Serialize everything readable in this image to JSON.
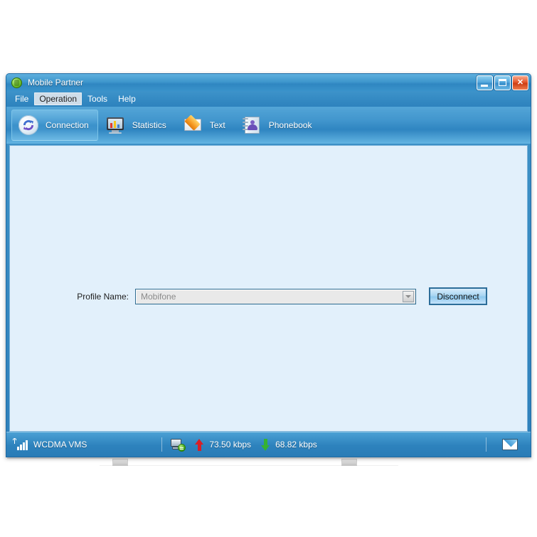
{
  "window": {
    "title": "Mobile Partner",
    "app_icon": "mobile-partner-icon",
    "controls": {
      "minimize_label": "Minimize",
      "maximize_label": "Maximize",
      "close_label": "✕"
    }
  },
  "menubar": {
    "items": [
      {
        "label": "File",
        "active": false
      },
      {
        "label": "Operation",
        "active": true
      },
      {
        "label": "Tools",
        "active": false
      },
      {
        "label": "Help",
        "active": false
      }
    ]
  },
  "toolbar": {
    "buttons": [
      {
        "label": "Connection",
        "icon": "connection-sync-icon",
        "selected": true
      },
      {
        "label": "Statistics",
        "icon": "statistics-monitor-icon",
        "selected": false
      },
      {
        "label": "Text",
        "icon": "text-envelope-icon",
        "selected": false
      },
      {
        "label": "Phonebook",
        "icon": "phonebook-icon",
        "selected": false
      }
    ]
  },
  "content": {
    "profile": {
      "label": "Profile Name:",
      "value": "Mobifone",
      "disabled": true,
      "dropdown_icon": "chevron-down-icon"
    },
    "action_button": {
      "label": "Disconnect"
    }
  },
  "statusbar": {
    "signal_icon": "signal-bars-icon",
    "network": "WCDMA  VMS",
    "device_icon": "connected-device-icon",
    "upload_icon": "arrow-up-icon",
    "upload_speed": "73.50 kbps",
    "download_icon": "arrow-down-icon",
    "download_speed": "68.82 kbps",
    "mail_icon": "mail-envelope-icon"
  },
  "colors": {
    "title_blue": "#3f93c8",
    "content_bg": "#e2f0fb",
    "accent_border": "#2c6d99",
    "upload_red": "#d81f26",
    "download_green": "#35b233",
    "menu_highlight": "#cfdde9"
  }
}
